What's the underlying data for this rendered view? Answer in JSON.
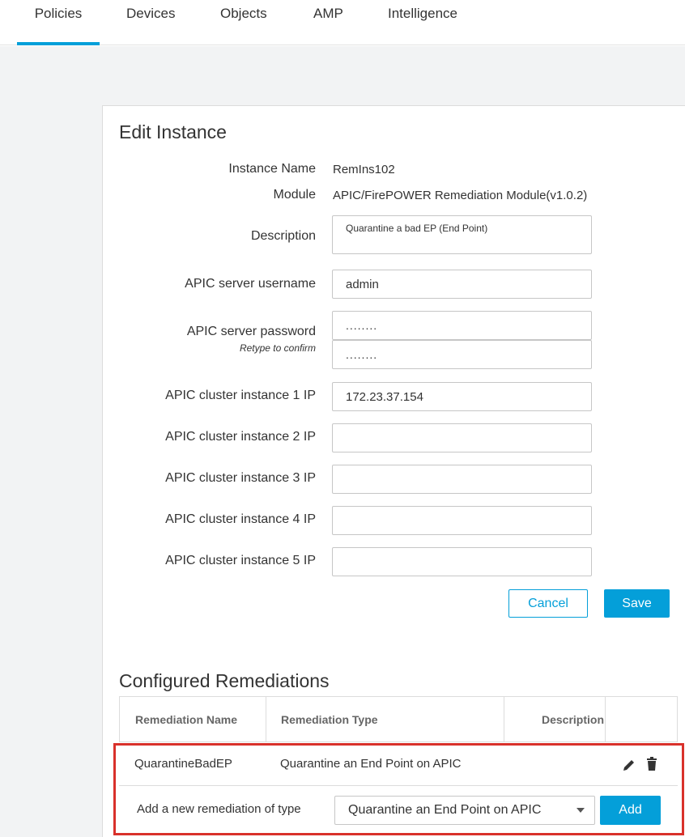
{
  "nav": {
    "tabs": [
      {
        "label": "Policies",
        "active": true
      },
      {
        "label": "Devices"
      },
      {
        "label": "Objects"
      },
      {
        "label": "AMP"
      },
      {
        "label": "Intelligence"
      }
    ]
  },
  "edit_instance": {
    "title": "Edit Instance",
    "instance_name_label": "Instance Name",
    "instance_name_value": "RemIns102",
    "module_label": "Module",
    "module_value": "APIC/FirePOWER Remediation Module(v1.0.2)",
    "description_label": "Description",
    "description_value": "Quarantine a bad EP (End Point)",
    "username_label": "APIC server username",
    "username_value": "admin",
    "password_label": "APIC server password",
    "password_hint": "Retype to confirm",
    "password_value": "........",
    "password_confirm_value": "........",
    "cluster_ip_labels": [
      "APIC cluster instance 1 IP",
      "APIC cluster instance 2 IP",
      "APIC cluster instance 3 IP",
      "APIC cluster instance 4 IP",
      "APIC cluster instance 5 IP"
    ],
    "cluster_ip_values": [
      "172.23.37.154",
      "",
      "",
      "",
      ""
    ],
    "cancel_label": "Cancel",
    "save_label": "Save"
  },
  "remediations": {
    "title": "Configured Remediations",
    "columns": [
      "Remediation Name",
      "Remediation Type",
      "Description"
    ],
    "rows": [
      {
        "name": "QuarantineBadEP",
        "type": "Quarantine an End Point on APIC",
        "description": ""
      }
    ],
    "add_label": "Add a new remediation of type",
    "add_select_value": "Quarantine an End Point on APIC",
    "add_button_label": "Add"
  },
  "colors": {
    "accent": "#049fd9",
    "highlight": "#d9312b",
    "background": "#f2f3f4"
  },
  "icons": [
    "edit-pencil-icon",
    "delete-trash-icon",
    "chevron-down-icon"
  ]
}
